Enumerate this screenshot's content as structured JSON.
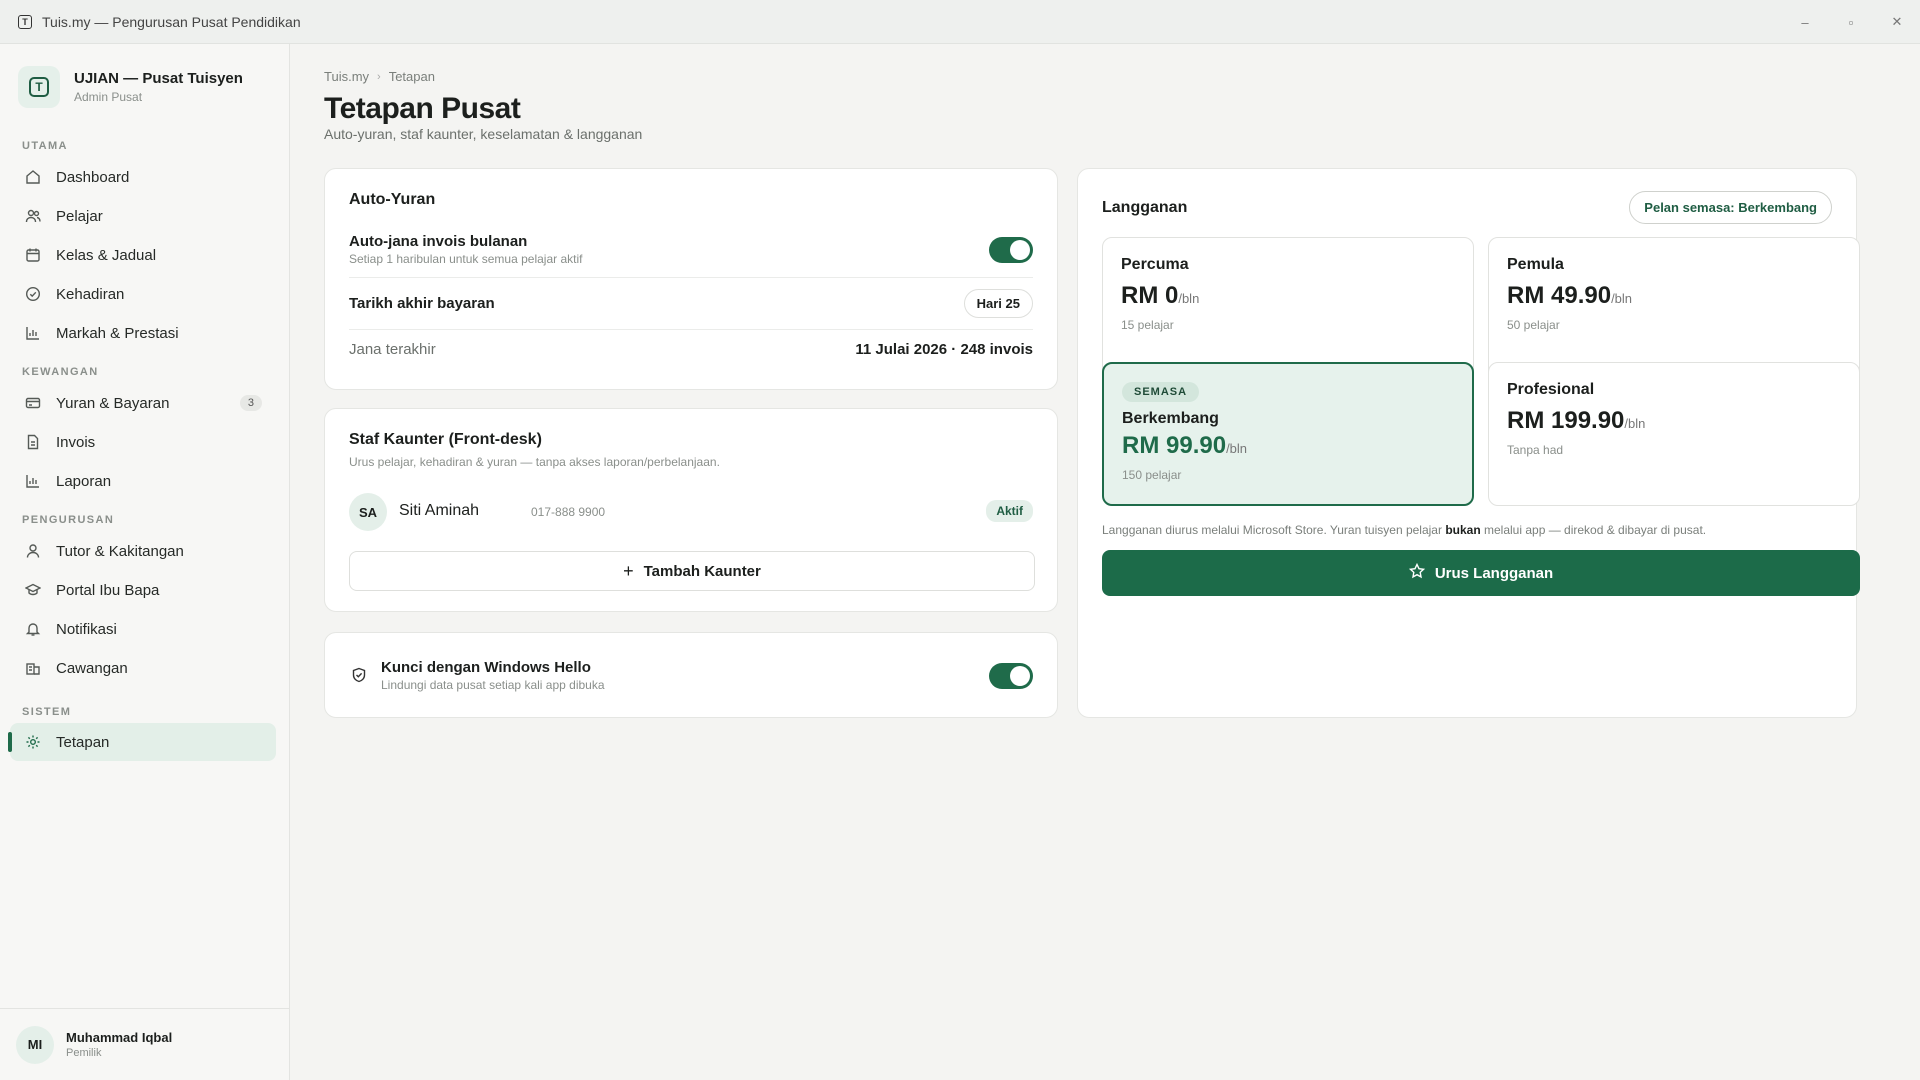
{
  "window": {
    "title": "Tuis.my — Pengurusan Pusat Pendidikan",
    "app_icon": "T",
    "controls": {
      "minimize": "–",
      "maximize": "▫",
      "close": "✕"
    }
  },
  "brand": {
    "logo": "T",
    "name": "UJIAN — Pusat Tuisyen",
    "role": "Admin Pusat"
  },
  "sidebar": {
    "sections": [
      {
        "label": "UTAMA"
      },
      {
        "label": "KEWANGAN"
      },
      {
        "label": "PENGURUSAN"
      },
      {
        "label": "SISTEM"
      }
    ],
    "items": [
      {
        "label": "Dashboard",
        "icon": "home-icon"
      },
      {
        "label": "Pelajar",
        "icon": "users-icon"
      },
      {
        "label": "Kelas & Jadual",
        "icon": "calendar-icon"
      },
      {
        "label": "Kehadiran",
        "icon": "check-circle-icon"
      },
      {
        "label": "Markah & Prestasi",
        "icon": "bar-chart-icon"
      },
      {
        "label": "Yuran & Bayaran",
        "icon": "card-icon",
        "badge": "3"
      },
      {
        "label": "Invois",
        "icon": "document-icon"
      },
      {
        "label": "Laporan",
        "icon": "bar-chart-icon"
      },
      {
        "label": "Tutor & Kakitangan",
        "icon": "person-icon"
      },
      {
        "label": "Portal Ibu Bapa",
        "icon": "graduation-cap-icon"
      },
      {
        "label": "Notifikasi",
        "icon": "bell-icon"
      },
      {
        "label": "Cawangan",
        "icon": "building-icon"
      },
      {
        "label": "Tetapan",
        "icon": "gear-icon",
        "active": true
      }
    ]
  },
  "user": {
    "initials": "MI",
    "name": "Muhammad Iqbal",
    "role": "Pemilik"
  },
  "page": {
    "breadcrumb": [
      "Tuis.my",
      "Tetapan"
    ],
    "title": "Tetapan Pusat",
    "subtitle": "Auto-yuran, staf kaunter, keselamatan & langganan"
  },
  "auto_fee": {
    "title": "Auto-Yuran",
    "auto_invoice_label": "Auto-jana invois bulanan",
    "auto_invoice_help": "Setiap 1 haribulan untuk semua pelajar aktif",
    "auto_invoice_on": true,
    "due_date_label": "Tarikh akhir bayaran",
    "due_date_value": "Hari 25",
    "last_run_label": "Jana terakhir",
    "last_run_value": "11 Julai 2026 · 248 invois"
  },
  "counter_staff": {
    "title": "Staf Kaunter (Front-desk)",
    "description": "Urus pelajar, kehadiran & yuran — tanpa akses laporan/perbelanjaan.",
    "staff": [
      {
        "initials": "SA",
        "name": "Siti Aminah",
        "phone": "017-888 9900",
        "status": "Aktif"
      }
    ],
    "add_button": "Tambah Kaunter"
  },
  "security": {
    "title": "Kunci dengan Windows Hello",
    "help": "Lindungi data pusat setiap kali app dibuka",
    "enabled": true
  },
  "subscription": {
    "title": "Langganan",
    "current_plan_pill": "Pelan semasa: Berkembang",
    "plans": [
      {
        "name": "Percuma",
        "price": "RM 0",
        "per": "/bln",
        "capacity": "15 pelajar"
      },
      {
        "name": "Pemula",
        "price": "RM 49.90",
        "per": "/bln",
        "capacity": "50 pelajar"
      },
      {
        "name": "Berkembang",
        "price": "RM 99.90",
        "per": "/bln",
        "capacity": "150 pelajar",
        "tag": "SEMASA",
        "current": true
      },
      {
        "name": "Profesional",
        "price": "RM 199.90",
        "per": "/bln",
        "capacity": "Tanpa had"
      }
    ],
    "note_prefix": "Langganan diurus melalui Microsoft Store. Yuran tuisyen pelajar ",
    "note_bold": "bukan",
    "note_suffix": " melalui app — direkod & dibayar di pusat.",
    "manage_button": "Urus Langganan",
    "accent_color": "#1c6b49"
  }
}
